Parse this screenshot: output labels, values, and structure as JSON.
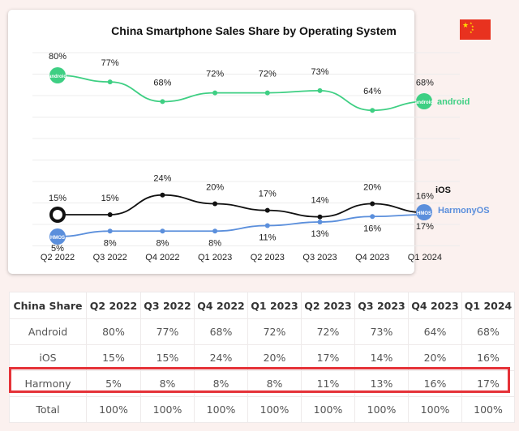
{
  "chart_data": {
    "type": "line",
    "title": "China Smartphone Sales Share by Operating System",
    "categories": [
      "Q2 2022",
      "Q3 2022",
      "Q4 2022",
      "Q1 2023",
      "Q2 2023",
      "Q3 2023",
      "Q4 2023",
      "Q1 2024"
    ],
    "series": [
      {
        "name": "android",
        "color": "#3ecf83",
        "values": [
          80,
          77,
          68,
          72,
          72,
          73,
          64,
          68
        ]
      },
      {
        "name": "iOS",
        "color": "#111111",
        "values": [
          15,
          15,
          24,
          20,
          17,
          14,
          20,
          16
        ]
      },
      {
        "name": "HarmonyOS",
        "color": "#5b8fdc",
        "values": [
          5,
          8,
          8,
          8,
          11,
          13,
          16,
          17
        ]
      }
    ],
    "data_labels": {
      "android": [
        "80%",
        "77%",
        "68%",
        "72%",
        "72%",
        "73%",
        "64%",
        "68%"
      ],
      "iOS": [
        "15%",
        "15%",
        "24%",
        "20%",
        "17%",
        "14%",
        "20%",
        "16%"
      ],
      "HarmonyOS": [
        "5%",
        "8%",
        "8%",
        "8%",
        "11%",
        "13%",
        "16%",
        "17%"
      ]
    },
    "xlabel": "",
    "ylabel": "",
    "grid": true,
    "legend": "right (end-of-line labels)",
    "icons": {
      "android": "android-logo-icon",
      "iOS": "apple-logo-icon",
      "HarmonyOS": "hmos-logo-icon",
      "flag": "china-flag-icon"
    }
  },
  "table": {
    "headers": [
      "China Share",
      "Q2 2022",
      "Q3 2022",
      "Q4 2022",
      "Q1 2023",
      "Q2 2023",
      "Q3 2023",
      "Q4 2023",
      "Q1 2024"
    ],
    "rows": [
      [
        "Android",
        "80%",
        "77%",
        "68%",
        "72%",
        "72%",
        "73%",
        "64%",
        "68%"
      ],
      [
        "iOS",
        "15%",
        "15%",
        "24%",
        "20%",
        "17%",
        "14%",
        "20%",
        "16%"
      ],
      [
        "Harmony",
        "5%",
        "8%",
        "8%",
        "8%",
        "11%",
        "13%",
        "16%",
        "17%"
      ],
      [
        "Total",
        "100%",
        "100%",
        "100%",
        "100%",
        "100%",
        "100%",
        "100%",
        "100%"
      ]
    ],
    "highlighted_row": "Harmony",
    "highlight_color": "#e53238"
  }
}
